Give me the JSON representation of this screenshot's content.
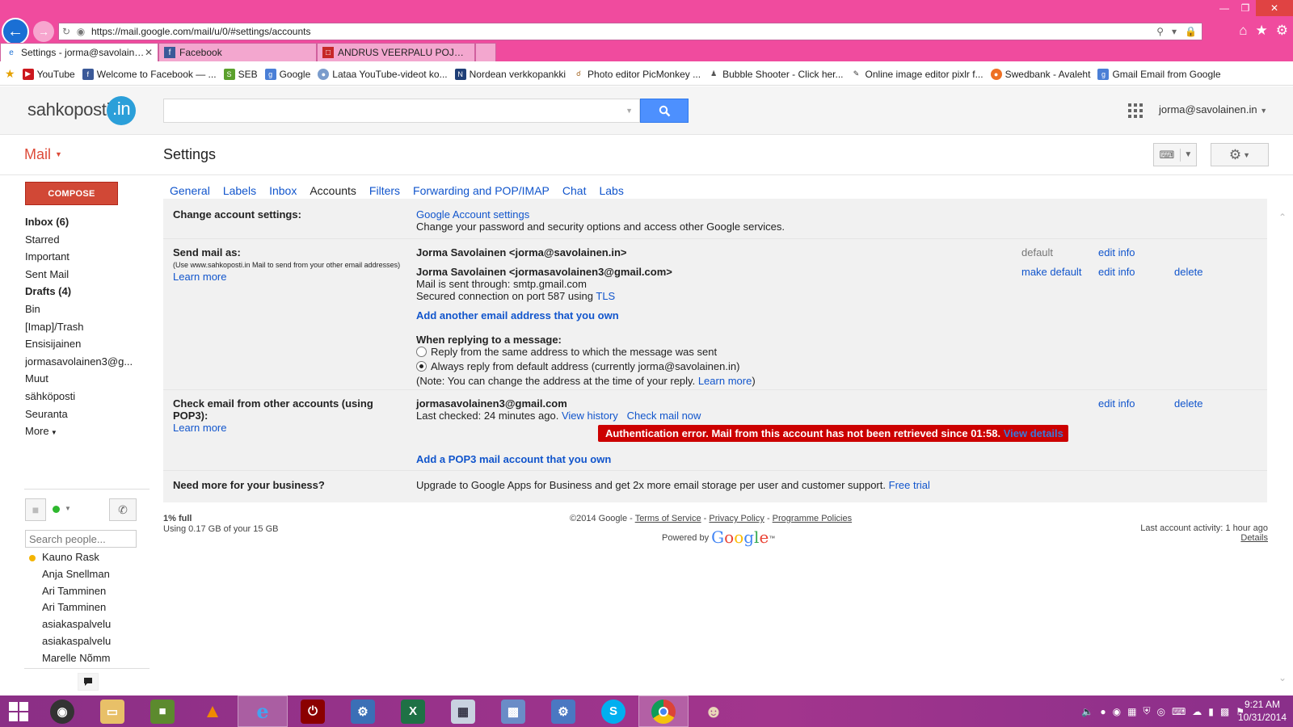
{
  "browser": {
    "url": "https://mail.google.com/mail/u/0/#settings/accounts",
    "tabs": [
      {
        "title": "Settings - jorma@savolaine...",
        "active": true
      },
      {
        "title": "Facebook",
        "active": false
      },
      {
        "title": "ANDRUS VEERPALU POJA AVA...",
        "active": false
      }
    ],
    "favorites": [
      "YouTube",
      "Welcome to Facebook — ...",
      "SEB",
      "Google",
      "Lataa YouTube-videot ko...",
      "Nordean verkkopankki",
      "Photo editor  PicMonkey ...",
      "Bubble Shooter - Click her...",
      "Online image editor pixlr f...",
      "Swedbank - Avaleht",
      "Gmail Email from Google"
    ]
  },
  "header": {
    "logo_text": "sahkoposti",
    "logo_suffix": ".in",
    "account": "jorma@savolainen.in"
  },
  "subheader": {
    "mail_label": "Mail",
    "page_title": "Settings"
  },
  "nav": {
    "compose": "COMPOSE",
    "items": [
      {
        "label": "Inbox (6)",
        "bold": true
      },
      {
        "label": "Starred",
        "bold": false
      },
      {
        "label": "Important",
        "bold": false
      },
      {
        "label": "Sent Mail",
        "bold": false
      },
      {
        "label": "Drafts (4)",
        "bold": true
      },
      {
        "label": "Bin",
        "bold": false
      },
      {
        "label": "[Imap]/Trash",
        "bold": false
      },
      {
        "label": "Ensisijainen",
        "bold": false
      },
      {
        "label": "jormasavolainen3@g...",
        "bold": false
      },
      {
        "label": "Muut",
        "bold": false
      },
      {
        "label": "sähköposti",
        "bold": false
      },
      {
        "label": "Seuranta",
        "bold": false
      },
      {
        "label": "More",
        "bold": false
      }
    ]
  },
  "chat": {
    "search_placeholder": "Search people...",
    "contacts": [
      "Kauno Rask",
      "Anja Snellman",
      "Ari Tamminen",
      "Ari Tamminen",
      "asiakaspalvelu",
      "asiakaspalvelu",
      "Marelle Nõmm"
    ]
  },
  "settings": {
    "tabs": [
      "General",
      "Labels",
      "Inbox",
      "Accounts",
      "Filters",
      "Forwarding and POP/IMAP",
      "Chat",
      "Labs"
    ],
    "selected_tab": "Accounts",
    "change_account": {
      "label": "Change account settings:",
      "link": "Google Account settings",
      "desc": "Change your password and security options and access other Google services."
    },
    "send_mail": {
      "label": "Send mail as:",
      "note": "(Use www.sahkoposti.in Mail to send from your other email addresses)",
      "learn_more": "Learn more",
      "addr1": "Jorma Savolainen <jorma@savolainen.in>",
      "addr1_status": "default",
      "addr2": "Jorma Savolainen <jormasavolainen3@gmail.com>",
      "addr2_make_default": "make default",
      "edit_info": "edit info",
      "delete": "delete",
      "smtp_line": "Mail is sent through: smtp.gmail.com",
      "secured_line": "Secured connection on port 587 using",
      "tls": "TLS",
      "add_another": "Add another email address that you own",
      "reply_heading": "When replying to a message:",
      "reply_opt1": "Reply from the same address to which the message was sent",
      "reply_opt2": "Always reply from default address (currently jorma@savolainen.in)",
      "reply_note": "(Note: You can change the address at the time of your reply.",
      "reply_note_link": "Learn more",
      "reply_note_end": ")"
    },
    "check_mail": {
      "label": "Check email from other accounts (using POP3):",
      "learn_more": "Learn more",
      "account": "jormasavolainen3@gmail.com",
      "last_checked": "Last checked: 24 minutes ago.",
      "view_history": "View history",
      "check_now": "Check mail now",
      "edit_info": "edit info",
      "delete": "delete",
      "error": "Authentication error. Mail from this account has not been retrieved since 01:58.",
      "error_link": "View details",
      "add_pop3": "Add a POP3 mail account that you own"
    },
    "business": {
      "label": "Need more for your business?",
      "text": "Upgrade to Google Apps for Business and get 2x more email storage per user and customer support.",
      "link": "Free trial"
    }
  },
  "footer": {
    "storage_pct": "1% full",
    "storage_used": "Using 0.17 GB of your 15 GB",
    "copyright": "©2014 Google -",
    "terms": "Terms of Service",
    "sep": "-",
    "privacy": "Privacy Policy",
    "policies": "Programme Policies",
    "powered_by": "Powered by",
    "google": "Google",
    "last_activity": "Last account activity: 1 hour ago",
    "details": "Details"
  },
  "taskbar": {
    "time": "9:21 AM",
    "date": "10/31/2014"
  },
  "colors": {
    "chrome_pink": "#f04b9e",
    "compose_red": "#d14836",
    "link_blue": "#1155cc",
    "error_red": "#cc0000",
    "search_blue": "#4d90fe"
  }
}
